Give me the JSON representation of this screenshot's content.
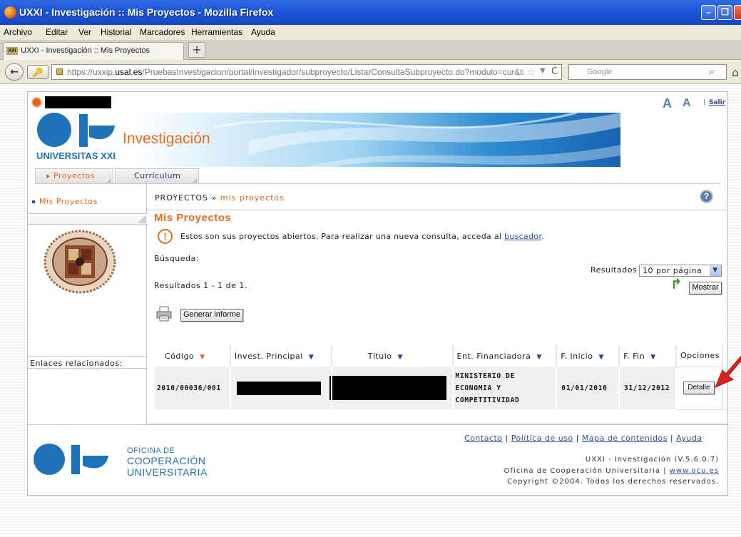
{
  "browser": {
    "window_title": "UXXI - Investigación :: Mis Proyectos - Mozilla Firefox",
    "menu": [
      "Archivo",
      "Editar",
      "Ver",
      "Historial",
      "Marcadores",
      "Herramientas",
      "Ayuda"
    ],
    "tab_favicon": "XXI",
    "tab_label": "UXXI - Investigación :: Mis Proyectos",
    "url_prefix": "https://uxxip.",
    "url_domain": "usal.es",
    "url_rest": "/PruebasInvestigacion/portal/investigador/subproyecto/ListarConsultaSubproyecto.do?modulo=cur&tipoCor",
    "search_engine": "Google"
  },
  "header": {
    "font_large": "A",
    "font_small": "A",
    "salir": "Salir"
  },
  "banner": {
    "title": "Investigación",
    "subtitle": "UNIVERSITAS XXI"
  },
  "tabs": {
    "proyectos": "Proyectos",
    "curriculum": "Currículum"
  },
  "sidebar": {
    "item": "Mis Proyectos",
    "enlaces": "Enlaces relacionados:"
  },
  "main": {
    "crumb_root": "PROYECTOS",
    "crumb_sep": "»",
    "crumb_current": "mis proyectos",
    "help": "?",
    "heading": "Mis Proyectos",
    "warn_icon": "!",
    "message": "Estos son sus proyectos abiertos. Para realizar una nueva consulta, acceda al",
    "message_link": "buscador",
    "message_end": ".",
    "busqueda": "Búsqueda:",
    "resultados_label": "Resultados",
    "per_page": "10 por página",
    "results_count": "Resultados 1 - 1 de 1.",
    "mostrar": "Mostrar",
    "generar": "Generar informe"
  },
  "table": {
    "headers": [
      "Código",
      "Invest. Principal",
      "Título",
      "Ent. Financiadora",
      "F. Inicio",
      "F. Fin",
      "Opciones"
    ],
    "row": {
      "codigo": "2010/00036/001",
      "entidad_1": "MINISTERIO DE",
      "entidad_2": "ECONOMIA Y",
      "entidad_3": "COMPETITIVIDAD",
      "inicio": "01/01/2010",
      "fin": "31/12/2012",
      "detalle": "Detalle"
    }
  },
  "footer": {
    "links": [
      "Contacto",
      "Política de uso",
      "Mapa de contenidos",
      "Ayuda"
    ],
    "sep": "|",
    "ocu_line1": "OFICINA DE",
    "ocu_line2": "COOPERACIÓN",
    "ocu_line3": "UNIVERSITARIA",
    "version": "UXXI - Investigación (V.5.6.0.7)",
    "ocu_name": "Oficina de Cooperación Universitaria |",
    "ocu_url": "www.ocu.es",
    "copyright": "Copyright ©2004. Todos los derechos reservados."
  },
  "colors": {
    "accent_orange": "#e46c1c",
    "brand_blue": "#1e72b8",
    "link_blue": "#2e4e9c"
  }
}
